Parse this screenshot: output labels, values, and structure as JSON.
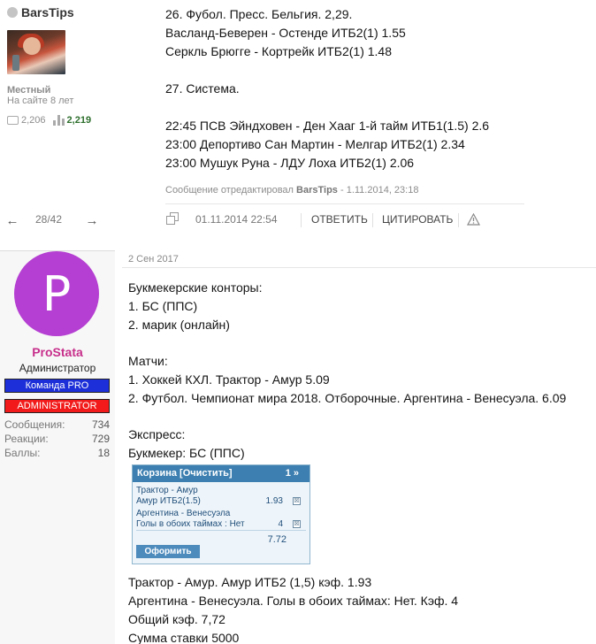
{
  "post1": {
    "author": "BarsTips",
    "rank": "Местный",
    "since": "На сайте 8 лет",
    "messages_count": "2,206",
    "likes_count": "2,219",
    "lines": [
      "26. Фубол. Пресс. Бельгия. 2,29.",
      "Васланд-Беверен - Остенде ИТБ2(1) 1.55",
      "Серкль Брюгге - Кортрейк ИТБ2(1) 1.48",
      "",
      "27. Система.",
      "",
      "22:45 ПСВ Эйндховен - Ден Хааг 1-й тайм ИТБ1(1.5) 2.6",
      "23:00 Депортиво Сан Мартин - Мелгар ИТБ2(1) 2.34",
      "23:00 Мушук Руна - ЛДУ Лоха ИТБ2(1) 2.06"
    ],
    "edited_prefix": "Сообщение отредактировал",
    "edited_by": "BarsTips",
    "edited_date": "- 1.11.2014, 23:18",
    "pager": {
      "prev": "←",
      "count": "28/42",
      "next": "→"
    },
    "date": "01.11.2014 22:54",
    "reply_label": "ОТВЕТИТЬ",
    "quote_label": "ЦИТИРОВАТЬ"
  },
  "post2": {
    "avatar_letter": "P",
    "avatar_color": "#b53fd2",
    "author": "ProStata",
    "title": "Администратор",
    "badge_team": "Команда PRO",
    "badge_admin": "ADMINISTRATOR",
    "stats": [
      {
        "label": "Сообщения:",
        "value": "734"
      },
      {
        "label": "Реакции:",
        "value": "729"
      },
      {
        "label": "Баллы:",
        "value": "18"
      }
    ],
    "date": "2 Сен 2017",
    "lines_a": [
      "Букмекерские конторы:",
      "1. БС (ППС)",
      "2. марик (онлайн)",
      "",
      "Матчи:",
      "1. Хоккей КХЛ. Трактор - Амур 5.09",
      "2. Футбол. Чемпионат мира 2018. Отборочные. Аргентина - Венесуэла. 6.09",
      "",
      "Экспресс:",
      "Букмекер: БС (ППС)"
    ],
    "lines_b": [
      "Трактор - Амур. Амур ИТБ2 (1,5) кэф. 1.93",
      "Аргентина - Венесуэла. Голы в обоих таймах: Нет. Кэф. 4",
      "Общий кэф. 7,72",
      "Сумма ставки 5000"
    ]
  },
  "basket": {
    "title": "Корзина [Очистить]",
    "count": "1 »",
    "items": [
      {
        "match": "Трактор - Амур",
        "bet": "Амур ИТБ2(1.5)",
        "odd": "1.93"
      },
      {
        "match": "Аргентина - Венесуэла",
        "bet": "Голы в обоих таймах : Нет",
        "odd": "4"
      }
    ],
    "total": "7.72",
    "submit_label": "Оформить",
    "remove_glyph": "☒"
  }
}
